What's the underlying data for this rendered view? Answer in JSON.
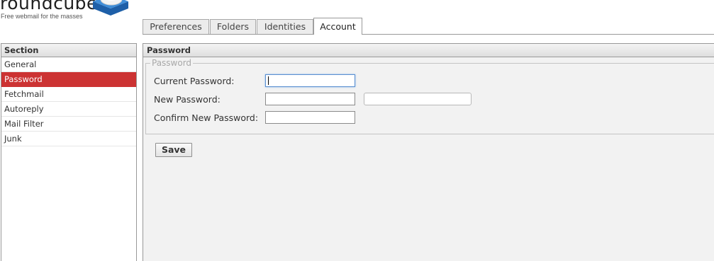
{
  "logo": {
    "wordmark": "roundcube",
    "tagline": "Free webmail for the masses",
    "icon": "roundcube-cube-icon"
  },
  "tabs": [
    {
      "label": "Preferences",
      "active": false
    },
    {
      "label": "Folders",
      "active": false
    },
    {
      "label": "Identities",
      "active": false
    },
    {
      "label": "Account",
      "active": true
    }
  ],
  "sidebar": {
    "header": "Section",
    "items": [
      {
        "label": "General",
        "selected": false
      },
      {
        "label": "Password",
        "selected": true
      },
      {
        "label": "Fetchmail",
        "selected": false
      },
      {
        "label": "Autoreply",
        "selected": false
      },
      {
        "label": "Mail Filter",
        "selected": false
      },
      {
        "label": "Junk",
        "selected": false
      }
    ]
  },
  "main": {
    "header": "Password",
    "fieldset_legend": "Password",
    "fields": {
      "current": {
        "label": "Current Password:",
        "value": ""
      },
      "new": {
        "label": "New Password:",
        "value": ""
      },
      "confirm": {
        "label": "Confirm New Password:",
        "value": ""
      }
    },
    "save_label": "Save"
  },
  "colors": {
    "selected_item": "#cc3333",
    "panel_background": "#f2f2f2",
    "focus_border": "#5a8fd0"
  }
}
